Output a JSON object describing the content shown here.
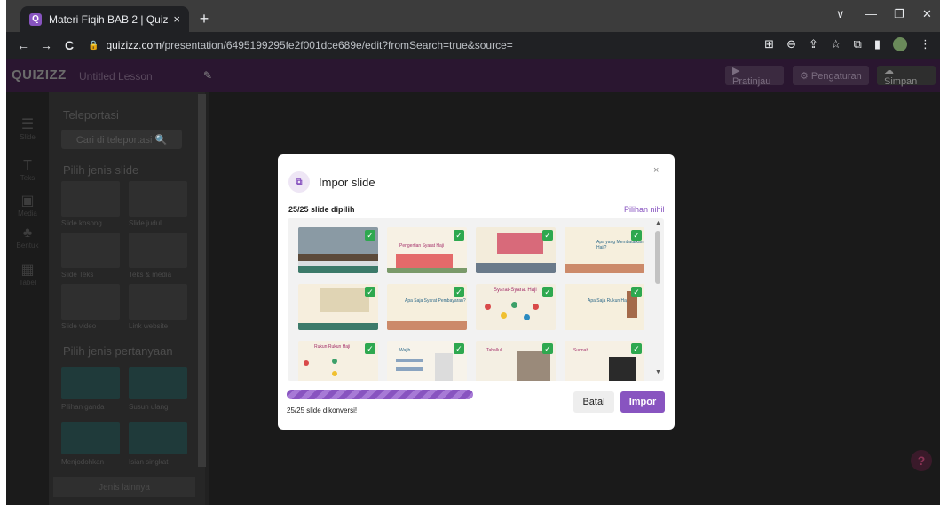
{
  "browser": {
    "tab_title": "Materi Fiqih BAB 2 | Quizizz",
    "favicon_letter": "Q",
    "tab_close": "×",
    "new_tab": "+",
    "url_host": "quizizz.com",
    "url_path": "/presentation/6495199295fe2f001dce689e/edit?fromSearch=true&source=",
    "nav": {
      "back": "←",
      "forward": "→",
      "reload": "C"
    },
    "window_controls": {
      "minimize": "—",
      "restore": "❐",
      "close": "✕",
      "dropdown": "∨"
    }
  },
  "app": {
    "logo": "QUIZIZZ",
    "lesson_title": "Untitled Lesson",
    "preview_label": "▶ Pratinjau",
    "settings_label": "⚙ Pengaturan",
    "save_label": "☁ Simpan",
    "rail": [
      {
        "icon": "☰",
        "label": "Slide"
      },
      {
        "icon": "T",
        "label": "Teks"
      },
      {
        "icon": "▣",
        "label": "Media"
      },
      {
        "icon": "♣",
        "label": "Bentuk"
      },
      {
        "icon": "▦",
        "label": "Tabel"
      }
    ],
    "panel": {
      "teleport_title": "Teleportasi",
      "teleport_search": "Cari di teleportasi 🔍",
      "slide_type_title": "Pilih jenis slide",
      "slide_types": [
        "Slide kosong",
        "Slide judul",
        "Slide Teks",
        "Teks & media",
        "Slide video",
        "Link website"
      ],
      "question_type_title": "Pilih jenis pertanyaan",
      "question_types": [
        "Pilihan ganda",
        "Susun ulang",
        "Menjodohkan",
        "Isian singkat"
      ],
      "bottom_button": "Jenis lainnya"
    },
    "help": "?"
  },
  "modal": {
    "title": "Impor slide",
    "close": "×",
    "selected_text": "25/25 slide dipilih",
    "clear_selection": "Pilihan nihil",
    "progress_text": "25/25 slide dikonversi!",
    "progress_percent": 100,
    "cancel_label": "Batal",
    "import_label": "Impor",
    "checkmark": "✓",
    "thumb_texts": [
      "",
      "Pengertian Syarat Haji",
      "",
      "Apa yang Membatalkan Haji?",
      "",
      "Apa Saja Syarat Pembayaran?",
      "Syarat-Syarat Haji",
      "Apa Saja Rukun Haji?",
      "Rukun Rukun Haji",
      "Wajib",
      "Tahallul",
      "Sunnah"
    ]
  }
}
